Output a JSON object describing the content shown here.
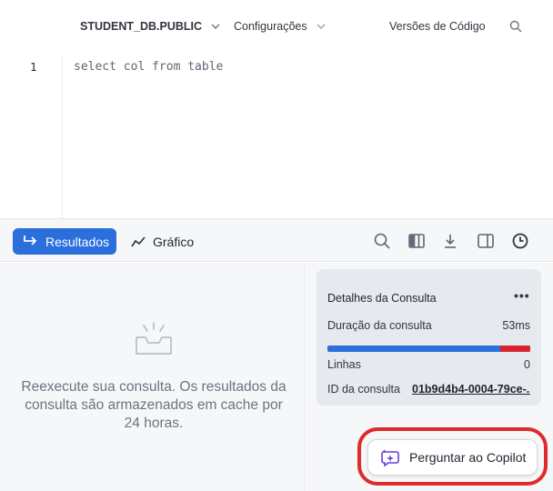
{
  "toolbar": {
    "database": "STUDENT_DB.PUBLIC",
    "config": "Configurações",
    "versions": "Versões de Código"
  },
  "editor": {
    "line_number": "1",
    "code": "select col from table"
  },
  "results": {
    "results_label": "Resultados",
    "chart_label": "Gráfico"
  },
  "empty_state": {
    "message": "Reexecute sua consulta. Os resultados da consulta são armazenados em cache por 24 horas."
  },
  "details": {
    "title": "Detalhes da Consulta",
    "more": "•••",
    "duration_label": "Duração da consulta",
    "duration_value": "53ms",
    "duration_bar": {
      "blue_fraction": 0.85,
      "red_fraction": 0.15
    },
    "rows_label": "Linhas",
    "rows_value": "0",
    "query_id_label": "ID da consulta",
    "query_id_value": "01b9d4b4-0004-79ce-..."
  },
  "copilot": {
    "label": "Perguntar ao Copilot"
  },
  "colors": {
    "accent": "#2b6fdc",
    "highlight_ring": "#e02a2a",
    "bar_red": "#d8232f"
  }
}
